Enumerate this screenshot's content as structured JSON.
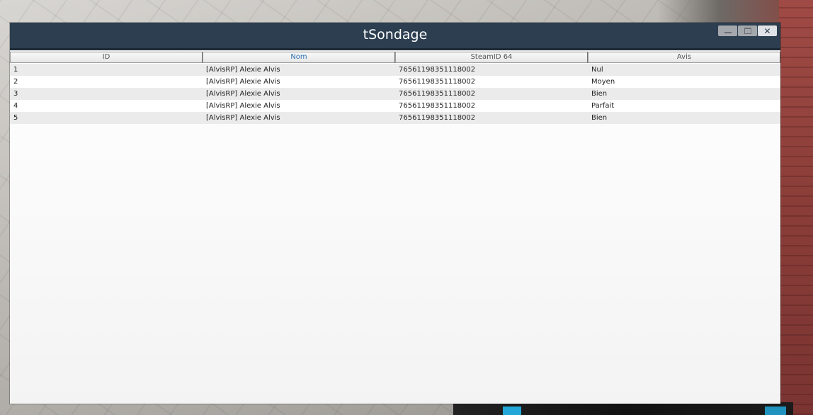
{
  "window": {
    "title": "tSondage",
    "buttons": {
      "minimize": "minimize-icon",
      "maximize": "maximize-icon",
      "close": "✕"
    }
  },
  "table": {
    "columns": [
      "ID",
      "Nom",
      "SteamID 64",
      "Avis"
    ],
    "active_column": "Nom",
    "rows": [
      {
        "id": "1",
        "nom": "[AlvisRP] Alexie Alvis",
        "steamid": "76561198351118002",
        "avis": "Nul"
      },
      {
        "id": "2",
        "nom": "[AlvisRP] Alexie Alvis",
        "steamid": "76561198351118002",
        "avis": "Moyen"
      },
      {
        "id": "3",
        "nom": "[AlvisRP] Alexie Alvis",
        "steamid": "76561198351118002",
        "avis": "Bien"
      },
      {
        "id": "4",
        "nom": "[AlvisRP] Alexie Alvis",
        "steamid": "76561198351118002",
        "avis": "Parfait"
      },
      {
        "id": "5",
        "nom": "[AlvisRP] Alexie Alvis",
        "steamid": "76561198351118002",
        "avis": "Bien"
      }
    ]
  },
  "colors": {
    "titlebar": "#2c3e50",
    "active_header_text": "#2a6fb0",
    "row_alt": "#ebebeb"
  }
}
